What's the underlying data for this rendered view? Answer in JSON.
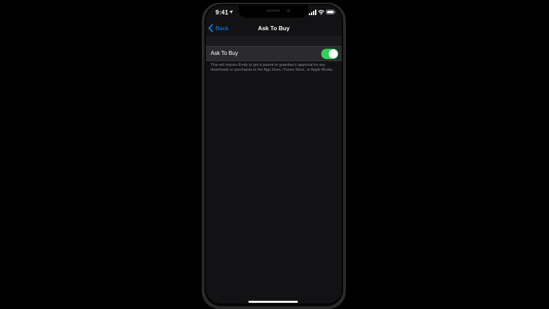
{
  "status_bar": {
    "time": "9:41",
    "icons": [
      "location-icon",
      "signal-icon",
      "wifi-icon",
      "battery-icon"
    ]
  },
  "nav": {
    "back_label": "Back",
    "title": "Ask To Buy"
  },
  "setting": {
    "label": "Ask To Buy",
    "toggle_on": true,
    "footer": "This will require Emily to get a parent or guardian's approval for any downloads or purchases in the App Store, iTunes Store, or Apple Books."
  },
  "colors": {
    "accent": "#0a84ff",
    "toggle_on": "#30d158",
    "background": "#121214",
    "cell": "#2b2b2e"
  }
}
